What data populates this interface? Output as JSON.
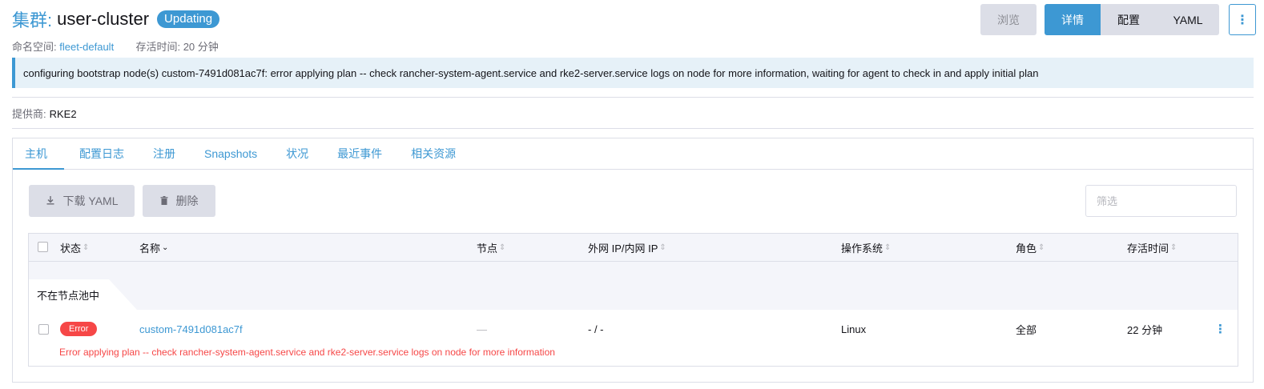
{
  "header": {
    "title_prefix": "集群:",
    "title_name": "user-cluster",
    "status_badge": "Updating",
    "namespace_label": "命名空间:",
    "namespace_value": "fleet-default",
    "age_label": "存活时间:",
    "age_value": "20 分钟"
  },
  "actions": {
    "browse": "浏览",
    "view_modes": [
      "详情",
      "配置",
      "YAML"
    ],
    "active_view": "详情",
    "more_icon": "vertical-ellipsis-icon"
  },
  "banner": {
    "message": "configuring bootstrap node(s) custom-7491d081ac7f: error applying plan -- check rancher-system-agent.service and rke2-server.service logs on node for more information, waiting for agent to check in and apply initial plan"
  },
  "provider": {
    "label": "提供商:",
    "value": "RKE2"
  },
  "tabs": [
    "主机",
    "配置日志",
    "注册",
    "Snapshots",
    "状况",
    "最近事件",
    "相关资源"
  ],
  "active_tab": "主机",
  "toolbar": {
    "download_label": "下载 YAML",
    "download_icon": "download-icon",
    "delete_label": "删除",
    "delete_icon": "trash-icon",
    "filter_placeholder": "筛选"
  },
  "table": {
    "columns": [
      "状态",
      "名称",
      "节点",
      "外网 IP/内网 IP",
      "操作系统",
      "角色",
      "存活时间"
    ],
    "sorted_column": "名称",
    "group_label": "不在节点池中",
    "rows": [
      {
        "status": "Error",
        "name": "custom-7491d081ac7f",
        "node": "—",
        "ip": "- / -",
        "os": "Linux",
        "role": "全部",
        "age": "22 分钟",
        "error_message": "Error applying plan -- check rancher-system-agent.service and rke2-server.service logs on node for more information"
      }
    ]
  },
  "colors": {
    "accent": "#3d98d3",
    "error": "#f64747",
    "banner_bg": "#e6f1f8",
    "button_bg": "#dcdee7"
  }
}
